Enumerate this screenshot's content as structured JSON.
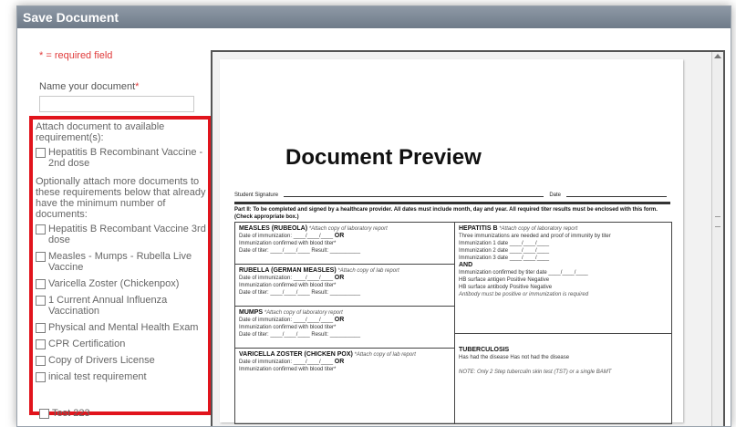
{
  "dialog": {
    "title": "Save Document",
    "required_note": "* = required field",
    "name_label": "Name your document",
    "name_required_mark": "*",
    "name_value": "",
    "attach_intro": "Attach document to available requirement(s):",
    "first_requirement": "Hepatitis B Recombinant Vaccine - 2nd dose",
    "optional_intro": "Optionally attach more documents to these requirements below that already have the minimum number of documents:",
    "optional_requirements": [
      "Hepatitis B Recombant Vaccine 3rd dose",
      "Measles - Mumps - Rubella Live Vaccine",
      "Varicella Zoster (Chickenpox)",
      "1 Current Annual Influenza Vaccination",
      "Physical and Mental Health Exam",
      "CPR Certification",
      "Copy of Drivers License",
      "inical test requirement"
    ],
    "last_item": "Test 223"
  },
  "preview": {
    "title": "Document Preview",
    "student_signature": "Student Signature",
    "date_label": "Date",
    "part2_text": "Part II: To be completed and signed by a healthcare provider.  All dates must include month, day and year. All required titer results must be enclosed with this form. (Check appropriate box.)",
    "sections": {
      "measles_title": "MEASLES (RUBEOLA)",
      "measles_note": "*Attach copy of laboratory report",
      "rubella_title": "RUBELLA (GERMAN MEASLES)",
      "rubella_note": "*Attach copy of lab report",
      "mumps_title": "MUMPS",
      "mumps_note": "*Attach copy of laboratory report",
      "varicella_title": "VARICELLA ZOSTER (CHICKEN POX)",
      "varicella_note": "*Attach copy of lab report",
      "hepb_title": "HEPATITIS B",
      "hepb_note": "*Attach copy of laboratory report",
      "hepb_line1": "Three immunizations are needed and proof of immunity by titer",
      "hepb_and": "AND",
      "tb_title": "TUBERCULOSIS",
      "tb_line1": "Has had the disease    Has not had the disease",
      "tb_note": "NOTE: Only 2 Step tuberculin skin test (TST) or a single BAMT"
    },
    "common": {
      "date_immunization": "Date of immunization: ____/____/____",
      "or": "OR",
      "confirmed_titer": "Immunization confirmed with blood titer*",
      "date_titer": "Date of titer: ____/____/____   Result: __________",
      "imm1": "Immunization 1 date ____/____/____",
      "imm2": "Immunization 2 date ____/____/____",
      "imm3": "Immunization 3 date ____/____/____",
      "titer_date": "Immunization confirmed by titer date ____/____/____",
      "hb_antigen": "HB surface antigen      Positive    Negative",
      "hb_antibody": "HB surface antibody    Positive    Negative",
      "antibody_note": "Antibody must be positive or immunization is required"
    }
  }
}
